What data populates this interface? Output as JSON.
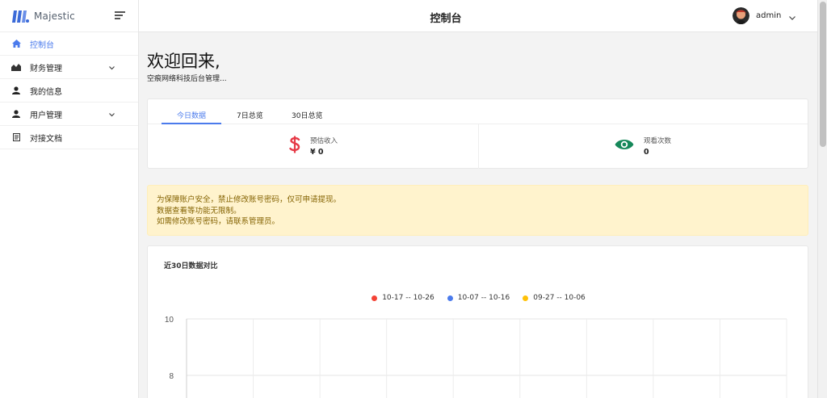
{
  "brand": {
    "name": "Majestic"
  },
  "sidebar": {
    "items": [
      {
        "label": "控制台",
        "icon": "home-icon",
        "active": true
      },
      {
        "label": "财务管理",
        "icon": "chart-area-icon",
        "has_children": true
      },
      {
        "label": "我的信息",
        "icon": "person-icon"
      },
      {
        "label": "用户管理",
        "icon": "person-icon",
        "has_children": true
      },
      {
        "label": "对接文档",
        "icon": "document-icon"
      }
    ]
  },
  "header": {
    "title": "控制台",
    "user": {
      "name": "admin"
    }
  },
  "main": {
    "welcome": "欢迎回来,",
    "subtitle": "空痕网络科技后台管理...",
    "tabs": [
      {
        "label": "今日数据",
        "active": true
      },
      {
        "label": "7日总览"
      },
      {
        "label": "30日总览"
      }
    ],
    "stats": [
      {
        "label": "预估收入",
        "value": "¥ 0",
        "icon": "dollar-icon",
        "color": "#e63946"
      },
      {
        "label": "观看次数",
        "value": "0",
        "icon": "eye-icon",
        "color": "#16885a"
      }
    ],
    "alert": {
      "lines": [
        "为保障账户安全，禁止修改账号密码，仅可申请提现。",
        "数据查看等功能无限制。",
        "如需修改账号密码，请联系管理员。"
      ]
    }
  },
  "chart_data": {
    "type": "line",
    "title": "近30日数据对比",
    "legend_position": "top-center",
    "series": [
      {
        "name": "10-17 -- 10-26",
        "color": "#f44336",
        "values": []
      },
      {
        "name": "10-07 -- 10-16",
        "color": "#4b7bec",
        "values": []
      },
      {
        "name": "09-27 -- 10-06",
        "color": "#ffc107",
        "values": []
      }
    ],
    "y_ticks": [
      "10",
      "8"
    ],
    "ylim": [
      0,
      10
    ],
    "grid": true,
    "x_gridlines": 9
  }
}
